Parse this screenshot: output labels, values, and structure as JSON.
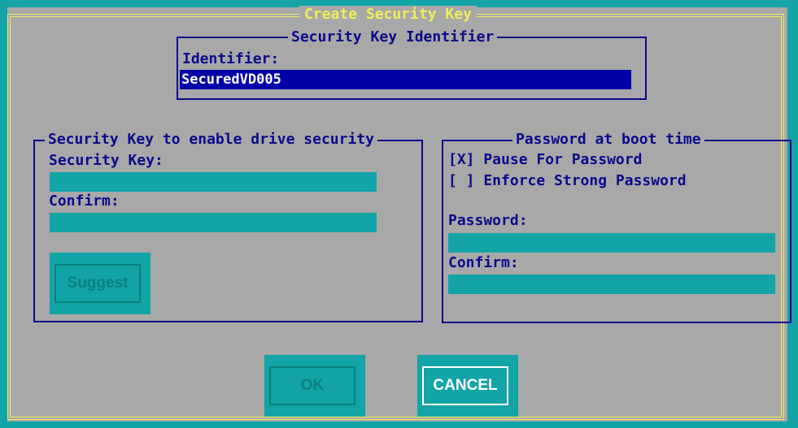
{
  "dialog": {
    "title": "Create Security Key"
  },
  "identifier_group": {
    "legend": "Security Key Identifier",
    "label": "Identifier:",
    "value": "SecuredVD005"
  },
  "security_key_group": {
    "legend": "Security Key to enable drive security",
    "key_label": "Security Key:",
    "key_value": "",
    "confirm_label": "Confirm:",
    "confirm_value": "",
    "suggest_label": "Suggest"
  },
  "boot_group": {
    "legend": "Password at boot time",
    "pause_checkbox": "[X] Pause For Password",
    "strong_checkbox": "[ ] Enforce Strong Password",
    "password_label": "Password:",
    "password_value": "",
    "confirm_label": "Confirm:",
    "confirm_value": ""
  },
  "buttons": {
    "ok_label": "OK",
    "cancel_label": "CANCEL"
  },
  "colors": {
    "background": "#a8a8a8",
    "accent_teal": "#12a4a6",
    "text_blue": "#0a0a8c",
    "title_yellow": "#f2ee58",
    "selection_blue": "#0000a8"
  }
}
